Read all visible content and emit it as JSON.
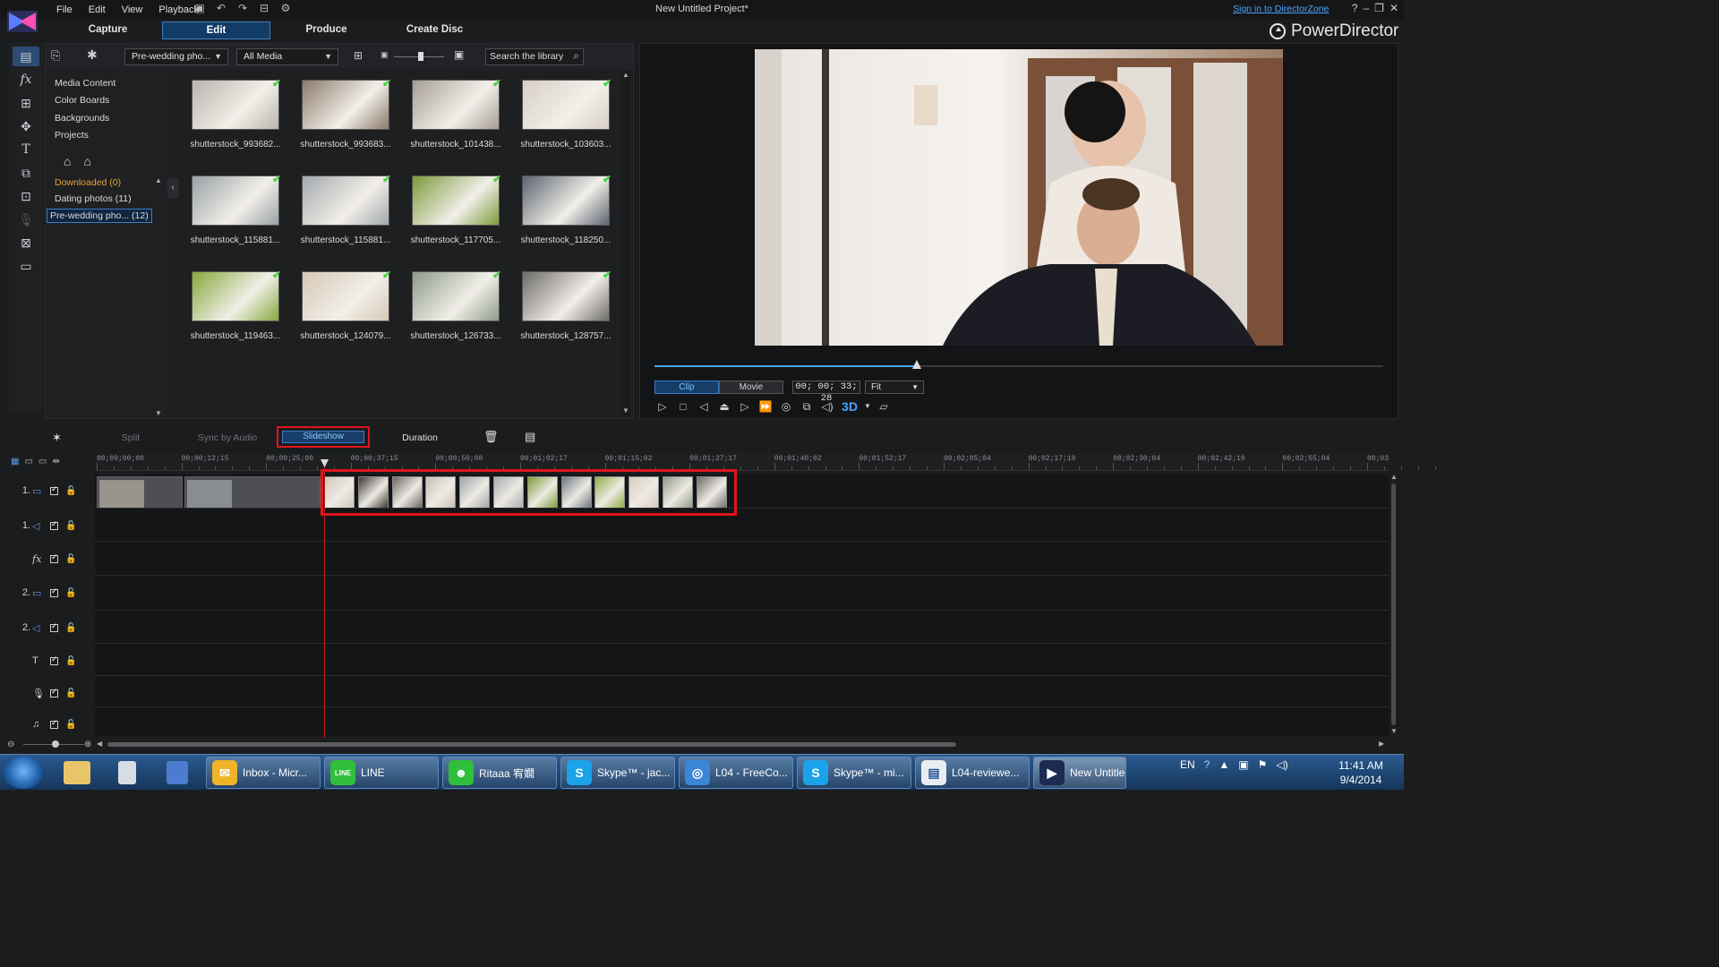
{
  "window": {
    "title": "New Untitled Project*",
    "signin": "Sign in to DirectorZone"
  },
  "menu": [
    "File",
    "Edit",
    "View",
    "Playback"
  ],
  "modes": [
    "Capture",
    "Edit",
    "Produce",
    "Create Disc"
  ],
  "brand": "PowerDirector",
  "library": {
    "filter_album": "Pre-wedding pho...",
    "filter_media": "All Media",
    "search_placeholder": "Search the library",
    "tree": [
      "Media Content",
      "Color Boards",
      "Backgrounds",
      "Projects"
    ],
    "tags": [
      "Downloaded  (0)",
      "Dating photos  (11)",
      "Pre-wedding pho...  (12)"
    ],
    "accent_downloaded": "#e6a23c",
    "thumbnails": [
      {
        "label": "shutterstock_993682...",
        "tone": "#b8b4ad"
      },
      {
        "label": "shutterstock_993683...",
        "tone": "#8b7a6a"
      },
      {
        "label": "shutterstock_101438...",
        "tone": "#a59d95"
      },
      {
        "label": "shutterstock_103603...",
        "tone": "#d7cfc7"
      },
      {
        "label": "shutterstock_115881...",
        "tone": "#9aa0a5"
      },
      {
        "label": "shutterstock_115881...",
        "tone": "#a3a8ad"
      },
      {
        "label": "shutterstock_117705...",
        "tone": "#7d9a3a"
      },
      {
        "label": "shutterstock_118250...",
        "tone": "#5b6470"
      },
      {
        "label": "shutterstock_119463...",
        "tone": "#86a83b"
      },
      {
        "label": "shutterstock_124079...",
        "tone": "#d6c8b6"
      },
      {
        "label": "shutterstock_126733...",
        "tone": "#8e9a88"
      },
      {
        "label": "shutterstock_128757...",
        "tone": "#6e6c69"
      }
    ]
  },
  "preview": {
    "modes": [
      "Clip",
      "Movie"
    ],
    "timecode": "00; 00; 33; 28",
    "fit": "Fit",
    "seek_fraction": 0.36,
    "three_d": "3D"
  },
  "timeline_toolbar": {
    "split": "Split",
    "sync": "Sync by Audio",
    "slideshow": "Slideshow",
    "duration": "Duration"
  },
  "ruler": [
    "00;00;00;00",
    "00;00;12;15",
    "00;00;25;00",
    "00;00;37;15",
    "00;00;50;00",
    "00;01;02;17",
    "00;01;15;02",
    "00;01;27;17",
    "00;01;40;02",
    "00;01;52;17",
    "00;02;05;04",
    "00;02;17;19",
    "00;02;30;04",
    "00;02;42;19",
    "00;02;55;04",
    "00;03"
  ],
  "tracks": [
    {
      "num": "1.",
      "icon": "video-track-icon"
    },
    {
      "num": "1.",
      "icon": "audio-track-icon"
    },
    {
      "num": "",
      "icon": "fx-track-icon"
    },
    {
      "num": "2.",
      "icon": "video-track-icon"
    },
    {
      "num": "2.",
      "icon": "audio-track-icon"
    },
    {
      "num": "",
      "icon": "title-track-icon"
    },
    {
      "num": "",
      "icon": "voice-track-icon"
    },
    {
      "num": "",
      "icon": "music-track-icon"
    }
  ],
  "slideshow_tones": [
    "#cfc7bd",
    "#3e3833",
    "#6b6560",
    "#c8c0b6",
    "#9fa4a8",
    "#a7abb0",
    "#7d9a3a",
    "#6f7780",
    "#8fad46",
    "#d7cabb",
    "#8e9a88",
    "#6e6c69"
  ],
  "taskbar": {
    "apps": [
      "Inbox - Micr...",
      "LINE",
      "Ritaaa 宥嫺",
      "Skype™ - jac...",
      "L04 - FreeCo...",
      "Skype™ - mi...",
      "L04-reviewe...",
      "New Untitled..."
    ],
    "lang": "EN",
    "time": "11:41 AM",
    "date": "9/4/2014"
  }
}
